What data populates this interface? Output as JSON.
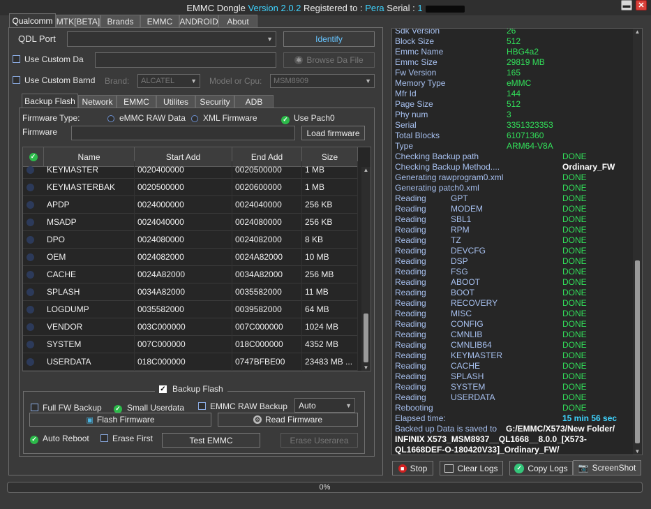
{
  "window": {
    "title_prefix": "EMMC Dongle",
    "version": "Version 2.0.2",
    "registered_label": "Registered to :",
    "registered_user": "Pera",
    "serial_label": "Serial :",
    "serial_visible": "1",
    "minimize": "▬",
    "close": "✕"
  },
  "main_tabs": [
    "Qualcomm",
    "MTK[BETA]",
    "Brands",
    "EMMC",
    "ANDROID",
    "About"
  ],
  "qdl": {
    "port_label": "QDL Port",
    "identify_label": "Identify",
    "use_custom_da_label": "Use Custom Da",
    "browse_da_label": "Browse Da File",
    "use_custom_brand_label": "Use Custom Barnd",
    "brand_label": "Brand:",
    "brand_value": "ALCATEL",
    "model_label": "Model or Cpu:",
    "model_value": "MSM8909"
  },
  "sub_tabs": [
    "Backup  Flash",
    "Network",
    "EMMC",
    "Utilites",
    "Security",
    "ADB"
  ],
  "firmware": {
    "type_label": "Firmware Type:",
    "raw_label": "eMMC RAW Data",
    "xml_label": "XML Firmware",
    "pach_label": "Use Pach0",
    "firmware_label": "Firmware",
    "load_label": "Load firmware"
  },
  "table": {
    "headers": [
      "Name",
      "Start Add",
      "End Add",
      "Size"
    ],
    "rows": [
      [
        "KEYMASTER",
        "0020400000",
        "0020500000",
        "1 MB"
      ],
      [
        "KEYMASTERBAK",
        "0020500000",
        "0020600000",
        "1 MB"
      ],
      [
        "APDP",
        "0024000000",
        "0024040000",
        "256 KB"
      ],
      [
        "MSADP",
        "0024040000",
        "0024080000",
        "256 KB"
      ],
      [
        "DPO",
        "0024080000",
        "0024082000",
        "8 KB"
      ],
      [
        "OEM",
        "0024082000",
        "0024A82000",
        "10 MB"
      ],
      [
        "CACHE",
        "0024A82000",
        "0034A82000",
        "256 MB"
      ],
      [
        "SPLASH",
        "0034A82000",
        "0035582000",
        "11 MB"
      ],
      [
        "LOGDUMP",
        "0035582000",
        "0039582000",
        "64 MB"
      ],
      [
        "VENDOR",
        "003C000000",
        "007C000000",
        "1024 MB"
      ],
      [
        "SYSTEM",
        "007C000000",
        "018C000000",
        "4352 MB"
      ],
      [
        "USERDATA",
        "018C000000",
        "0747BFBE00",
        "23483 MB ..."
      ]
    ]
  },
  "backup": {
    "group_label": "Backup  Flash",
    "full_fw_label": "Full FW Backup",
    "small_userdata_label": "Small Userdata",
    "emmc_raw_label": "EMMC RAW Backup",
    "mode_value": "Auto",
    "flash_label": "Flash Firmware",
    "read_label": "Read Firmware",
    "auto_reboot_label": "Auto Reboot",
    "erase_first_label": "Erase First",
    "test_label": "Test EMMC",
    "erase_userarea_label": "Erase Userarea"
  },
  "log": {
    "info": [
      [
        "Sdk Version",
        "26"
      ],
      [
        "Block Size",
        "512"
      ],
      [
        "Emmc Name",
        "HBG4a2"
      ],
      [
        "Emmc Size",
        "29819 MB"
      ],
      [
        "Fw Version",
        "165"
      ],
      [
        "Memory Type",
        "eMMC"
      ],
      [
        "Mfr Id",
        "144"
      ],
      [
        "Page Size",
        "512"
      ],
      [
        "Phy num",
        "3"
      ],
      [
        "Serial",
        "3351323353"
      ],
      [
        "Total Blocks",
        "61071360"
      ],
      [
        "Type",
        "ARM64-V8A"
      ]
    ],
    "steps": [
      [
        "Checking Backup path",
        "DONE"
      ],
      [
        "Checking Backup Method....",
        "Ordinary_FW"
      ],
      [
        "Generating rawprogram0.xml",
        "DONE"
      ],
      [
        "Generating patch0.xml",
        "DONE"
      ]
    ],
    "reading_label": "Reading",
    "reading": [
      "GPT",
      "MODEM",
      "SBL1",
      "RPM",
      "TZ",
      "DEVCFG",
      "DSP",
      "FSG",
      "ABOOT",
      "BOOT",
      "RECOVERY",
      "MISC",
      "CONFIG",
      "CMNLIB",
      "CMNLIB64",
      "KEYMASTER",
      "CACHE",
      "SPLASH",
      "SYSTEM",
      "USERDATA"
    ],
    "done": "DONE",
    "rebooting_label": "Rebooting",
    "elapsed_label": "Elapsed time:",
    "elapsed_value": "15 min  56 sec",
    "saved_label": "Backed up Data is saved to",
    "saved_path_1": "G:/EMMC/X573/New Folder/",
    "saved_path_2": "INFINIX X573_MSM8937__QL1668__8.0.0_[X573-",
    "saved_path_3": "QL1668DEF-O-180420V33]_Ordinary_FW/"
  },
  "bottom_buttons": {
    "stop": "Stop",
    "clear": "Clear Logs",
    "copy": "Copy Logs",
    "screenshot": "ScreenShot"
  },
  "progress": {
    "value": 0,
    "text": "0%"
  }
}
